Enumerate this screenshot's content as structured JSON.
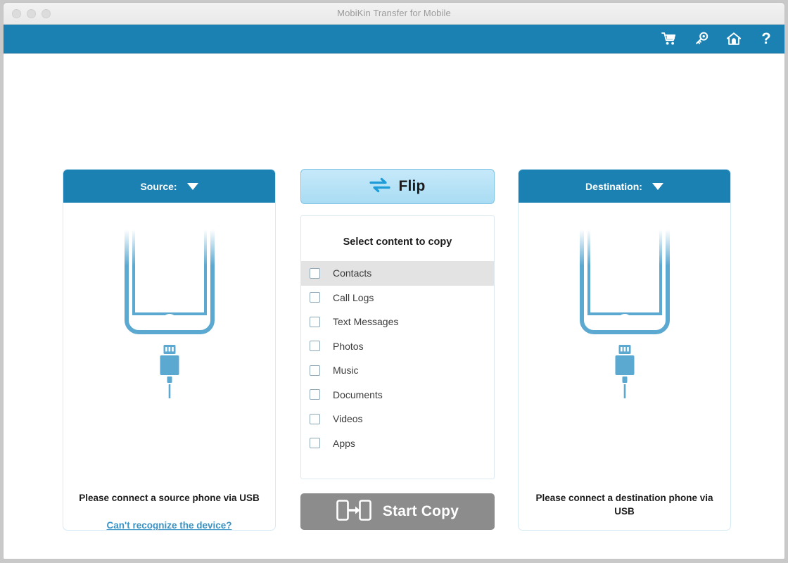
{
  "window": {
    "title": "MobiKin Transfer for Mobile",
    "traffic_lights": [
      "close",
      "minimize",
      "zoom"
    ]
  },
  "toolbar": {
    "icons": [
      {
        "name": "cart-icon",
        "glyph": "shopping-cart"
      },
      {
        "name": "key-icon",
        "glyph": "key"
      },
      {
        "name": "home-icon",
        "glyph": "home"
      },
      {
        "name": "help-icon",
        "glyph": "?"
      }
    ],
    "help_label": "?",
    "background": "#1b80b2"
  },
  "source_panel": {
    "header_label": "Source:",
    "note": "Please connect a source phone via USB",
    "link_label": "Can't recognize the device?"
  },
  "destination_panel": {
    "header_label": "Destination:",
    "note": "Please connect a destination phone via USB"
  },
  "center": {
    "flip_label": "Flip",
    "select_title": "Select content to copy",
    "content_items": [
      {
        "label": "Contacts",
        "checked": false,
        "highlighted": true
      },
      {
        "label": "Call Logs",
        "checked": false,
        "highlighted": false
      },
      {
        "label": "Text Messages",
        "checked": false,
        "highlighted": false
      },
      {
        "label": "Photos",
        "checked": false,
        "highlighted": false
      },
      {
        "label": "Music",
        "checked": false,
        "highlighted": false
      },
      {
        "label": "Documents",
        "checked": false,
        "highlighted": false
      },
      {
        "label": "Videos",
        "checked": false,
        "highlighted": false
      },
      {
        "label": "Apps",
        "checked": false,
        "highlighted": false
      }
    ],
    "start_label": "Start Copy",
    "start_enabled": false
  },
  "colors": {
    "accent_blue": "#1b80b2",
    "flip_blue": "#b8e2f5",
    "phone_blue": "#5ba8d0",
    "link_blue": "#3a93c4",
    "disabled_gray": "#8c8c8c",
    "row_highlight": "#e3e3e3"
  }
}
